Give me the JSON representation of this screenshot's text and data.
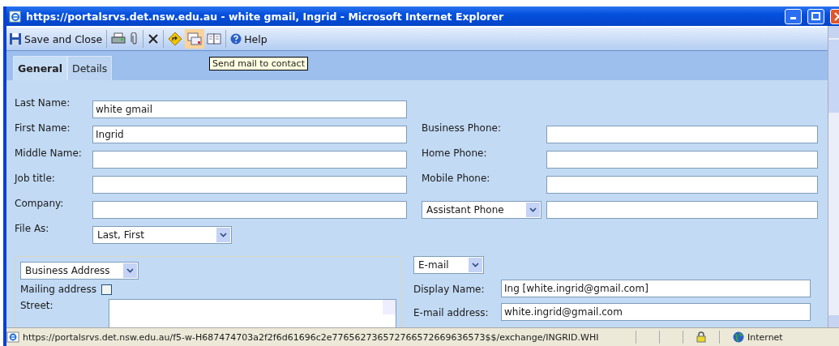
{
  "window": {
    "title": "https://portalsrvs.det.nsw.edu.au - white gmail, Ingrid - Microsoft Internet Explorer"
  },
  "toolbar": [
    {
      "kind": "save",
      "label": "Save and Close",
      "hovered": false
    },
    {
      "kind": "print",
      "hovered": false
    },
    {
      "kind": "attach",
      "hovered": false
    },
    {
      "kind": "delete",
      "hovered": false
    },
    {
      "kind": "flag",
      "hovered": false
    },
    {
      "kind": "mail",
      "hovered": true
    },
    {
      "kind": "book",
      "hovered": false
    },
    {
      "kind": "help",
      "label": "Help",
      "hovered": false
    }
  ],
  "tooltip": "Send mail to contact",
  "tabs": [
    {
      "label": "General",
      "selected": true
    },
    {
      "label": "Details",
      "selected": false
    }
  ],
  "name_fields": [
    {
      "label": "Last Name:",
      "value": "white gmail"
    },
    {
      "label": "First Name:",
      "value": "Ingrid"
    },
    {
      "label": "Middle Name:"
    },
    {
      "label": "Job title:"
    },
    {
      "label": "Company:"
    }
  ],
  "file_as": {
    "label": "File As:",
    "value": "Last, First"
  },
  "phone_fields": [
    {
      "kind": "label",
      "label": "Business Phone:"
    },
    {
      "kind": "label",
      "label": "Home Phone:"
    },
    {
      "kind": "label",
      "label": "Mobile Phone:"
    },
    {
      "kind": "select",
      "label": "Assistant Phone"
    }
  ],
  "address": {
    "type": "Business Address",
    "mailing_label": "Mailing address",
    "mailing_checked": false,
    "street_label": "Street:"
  },
  "email": {
    "type": "E-mail",
    "display_name_label": "Display Name:",
    "display_name": "Ing [white.ingrid@gmail.com]",
    "address_label": "E-mail address:",
    "address": "white.ingrid@gmail.com"
  },
  "status_bar": {
    "url": "https://portalsrvs.det.nsw.edu.au/f5-w-H687474703a2f2f6d61696c2e776562736572766572669636573$$/exchange/INGRID.WHI",
    "zone": "Internet"
  }
}
